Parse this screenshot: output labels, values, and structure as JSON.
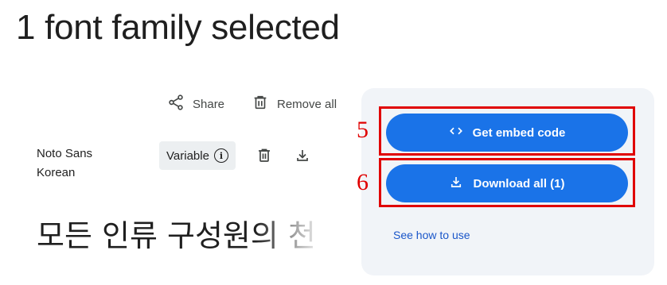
{
  "page": {
    "title": "1 font family selected"
  },
  "toolbar": {
    "share_label": "Share",
    "remove_all_label": "Remove all"
  },
  "family": {
    "name": "Noto Sans Korean",
    "variable_label": "Variable",
    "sample_text": "모든 인류 구성원의 천"
  },
  "panel": {
    "embed_label": "Get embed code",
    "download_label": "Download all (1)",
    "see_how_label": "See how to use"
  },
  "annotations": [
    {
      "label": "5",
      "target": "embed"
    },
    {
      "label": "6",
      "target": "download"
    }
  ],
  "colors": {
    "primary": "#1a73e8",
    "annotation": "#e00000",
    "panel_bg": "#f1f4f8"
  }
}
